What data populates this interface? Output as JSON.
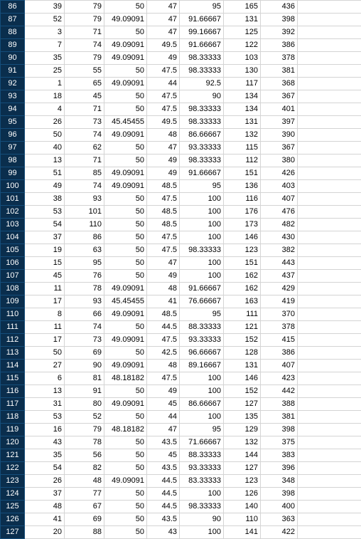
{
  "highlightRange": [
    86,
    127
  ],
  "rows": [
    {
      "n": 86,
      "c": [
        39,
        79,
        50,
        47,
        95,
        165,
        436
      ]
    },
    {
      "n": 87,
      "c": [
        52,
        79,
        49.09091,
        47,
        91.66667,
        131,
        398
      ]
    },
    {
      "n": 88,
      "c": [
        3,
        71,
        50,
        47,
        99.16667,
        125,
        392
      ]
    },
    {
      "n": 89,
      "c": [
        7,
        74,
        49.09091,
        49.5,
        91.66667,
        122,
        386
      ]
    },
    {
      "n": 90,
      "c": [
        35,
        79,
        49.09091,
        49,
        98.33333,
        103,
        378
      ]
    },
    {
      "n": 91,
      "c": [
        25,
        55,
        50,
        47.5,
        98.33333,
        130,
        381
      ]
    },
    {
      "n": 92,
      "c": [
        1,
        65,
        49.09091,
        44,
        92.5,
        117,
        368
      ]
    },
    {
      "n": 93,
      "c": [
        18,
        45,
        50,
        47.5,
        90,
        134,
        367
      ]
    },
    {
      "n": 94,
      "c": [
        4,
        71,
        50,
        47.5,
        98.33333,
        134,
        401
      ]
    },
    {
      "n": 95,
      "c": [
        26,
        73,
        45.45455,
        49.5,
        98.33333,
        131,
        397
      ]
    },
    {
      "n": 96,
      "c": [
        50,
        74,
        49.09091,
        48,
        86.66667,
        132,
        390
      ]
    },
    {
      "n": 97,
      "c": [
        40,
        62,
        50,
        47,
        93.33333,
        115,
        367
      ]
    },
    {
      "n": 98,
      "c": [
        13,
        71,
        50,
        49,
        98.33333,
        112,
        380
      ]
    },
    {
      "n": 99,
      "c": [
        51,
        85,
        49.09091,
        49,
        91.66667,
        151,
        426
      ]
    },
    {
      "n": 100,
      "c": [
        49,
        74,
        49.09091,
        48.5,
        95,
        136,
        403
      ]
    },
    {
      "n": 101,
      "c": [
        38,
        93,
        50,
        47.5,
        100,
        116,
        407
      ]
    },
    {
      "n": 102,
      "c": [
        53,
        101,
        50,
        48.5,
        100,
        176,
        476
      ]
    },
    {
      "n": 103,
      "c": [
        54,
        110,
        50,
        48.5,
        100,
        173,
        482
      ]
    },
    {
      "n": 104,
      "c": [
        37,
        86,
        50,
        47.5,
        100,
        146,
        430
      ]
    },
    {
      "n": 105,
      "c": [
        19,
        63,
        50,
        47.5,
        98.33333,
        123,
        382
      ]
    },
    {
      "n": 106,
      "c": [
        15,
        95,
        50,
        47,
        100,
        151,
        443
      ]
    },
    {
      "n": 107,
      "c": [
        45,
        76,
        50,
        49,
        100,
        162,
        437
      ]
    },
    {
      "n": 108,
      "c": [
        11,
        78,
        49.09091,
        48,
        91.66667,
        162,
        429
      ]
    },
    {
      "n": 109,
      "c": [
        17,
        93,
        45.45455,
        41,
        76.66667,
        163,
        419
      ]
    },
    {
      "n": 110,
      "c": [
        8,
        66,
        49.09091,
        48.5,
        95,
        111,
        370
      ]
    },
    {
      "n": 111,
      "c": [
        11,
        74,
        50,
        44.5,
        88.33333,
        121,
        378
      ]
    },
    {
      "n": 112,
      "c": [
        17,
        73,
        49.09091,
        47.5,
        93.33333,
        152,
        415
      ]
    },
    {
      "n": 113,
      "c": [
        50,
        69,
        50,
        42.5,
        96.66667,
        128,
        386
      ]
    },
    {
      "n": 114,
      "c": [
        27,
        90,
        49.09091,
        48,
        89.16667,
        131,
        407
      ]
    },
    {
      "n": 115,
      "c": [
        6,
        81,
        48.18182,
        47.5,
        100,
        146,
        423
      ]
    },
    {
      "n": 116,
      "c": [
        13,
        91,
        50,
        49,
        100,
        152,
        442
      ]
    },
    {
      "n": 117,
      "c": [
        31,
        80,
        49.09091,
        45,
        86.66667,
        127,
        388
      ]
    },
    {
      "n": 118,
      "c": [
        53,
        52,
        50,
        44,
        100,
        135,
        381
      ]
    },
    {
      "n": 119,
      "c": [
        16,
        79,
        48.18182,
        47,
        95,
        129,
        398
      ]
    },
    {
      "n": 120,
      "c": [
        43,
        78,
        50,
        43.5,
        71.66667,
        132,
        375
      ]
    },
    {
      "n": 121,
      "c": [
        35,
        56,
        50,
        45,
        88.33333,
        144,
        383
      ]
    },
    {
      "n": 122,
      "c": [
        54,
        82,
        50,
        43.5,
        93.33333,
        127,
        396
      ]
    },
    {
      "n": 123,
      "c": [
        26,
        48,
        49.09091,
        44.5,
        83.33333,
        123,
        348
      ]
    },
    {
      "n": 124,
      "c": [
        37,
        77,
        50,
        44.5,
        100,
        126,
        398
      ]
    },
    {
      "n": 125,
      "c": [
        48,
        67,
        50,
        44.5,
        98.33333,
        140,
        400
      ]
    },
    {
      "n": 126,
      "c": [
        41,
        69,
        50,
        43.5,
        90,
        110,
        363
      ]
    },
    {
      "n": 127,
      "c": [
        20,
        88,
        50,
        43,
        100,
        141,
        422
      ]
    }
  ]
}
